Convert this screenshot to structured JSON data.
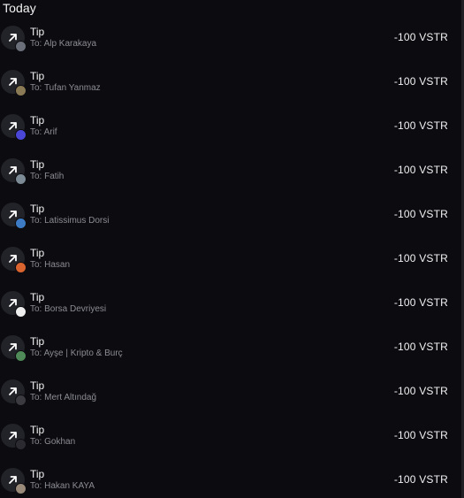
{
  "section_title": "Today",
  "transactions": [
    {
      "title": "Tip",
      "recipient": "To: Alp Karakaya",
      "amount": "-100 VSTR",
      "avatar_color": "#6b6f7a",
      "icon": "arrow-up-right-icon"
    },
    {
      "title": "Tip",
      "recipient": "To: Tufan Yanmaz",
      "amount": "-100 VSTR",
      "avatar_color": "#8a7a55",
      "icon": "arrow-up-right-icon"
    },
    {
      "title": "Tip",
      "recipient": "To: Arif",
      "amount": "-100 VSTR",
      "avatar_color": "#4a46d6",
      "icon": "arrow-up-right-icon"
    },
    {
      "title": "Tip",
      "recipient": "To: Fatih",
      "amount": "-100 VSTR",
      "avatar_color": "#7c8b96",
      "icon": "arrow-up-right-icon"
    },
    {
      "title": "Tip",
      "recipient": "To: Latissimus Dorsi",
      "amount": "-100 VSTR",
      "avatar_color": "#3d7cc4",
      "icon": "arrow-up-right-icon"
    },
    {
      "title": "Tip",
      "recipient": "To: Hasan",
      "amount": "-100 VSTR",
      "avatar_color": "#d9642f",
      "icon": "arrow-up-right-icon"
    },
    {
      "title": "Tip",
      "recipient": "To: Borsa Devriyesi",
      "amount": "-100 VSTR",
      "avatar_color": "#eeeeee",
      "icon": "arrow-up-right-icon"
    },
    {
      "title": "Tip",
      "recipient": "To: Ayşe | Kripto & Burç",
      "amount": "-100 VSTR",
      "avatar_color": "#4f8a58",
      "icon": "arrow-up-right-icon"
    },
    {
      "title": "Tip",
      "recipient": "To: Mert Altındağ",
      "amount": "-100 VSTR",
      "avatar_color": "#3a3a40",
      "icon": "arrow-up-right-icon"
    },
    {
      "title": "Tip",
      "recipient": "To: Gokhan",
      "amount": "-100 VSTR",
      "avatar_color": "#2a2a30",
      "icon": "arrow-up-right-icon"
    },
    {
      "title": "Tip",
      "recipient": "To: Hakan KAYA",
      "amount": "-100 VSTR",
      "avatar_color": "#9a8a7a",
      "icon": "arrow-up-right-icon"
    }
  ]
}
